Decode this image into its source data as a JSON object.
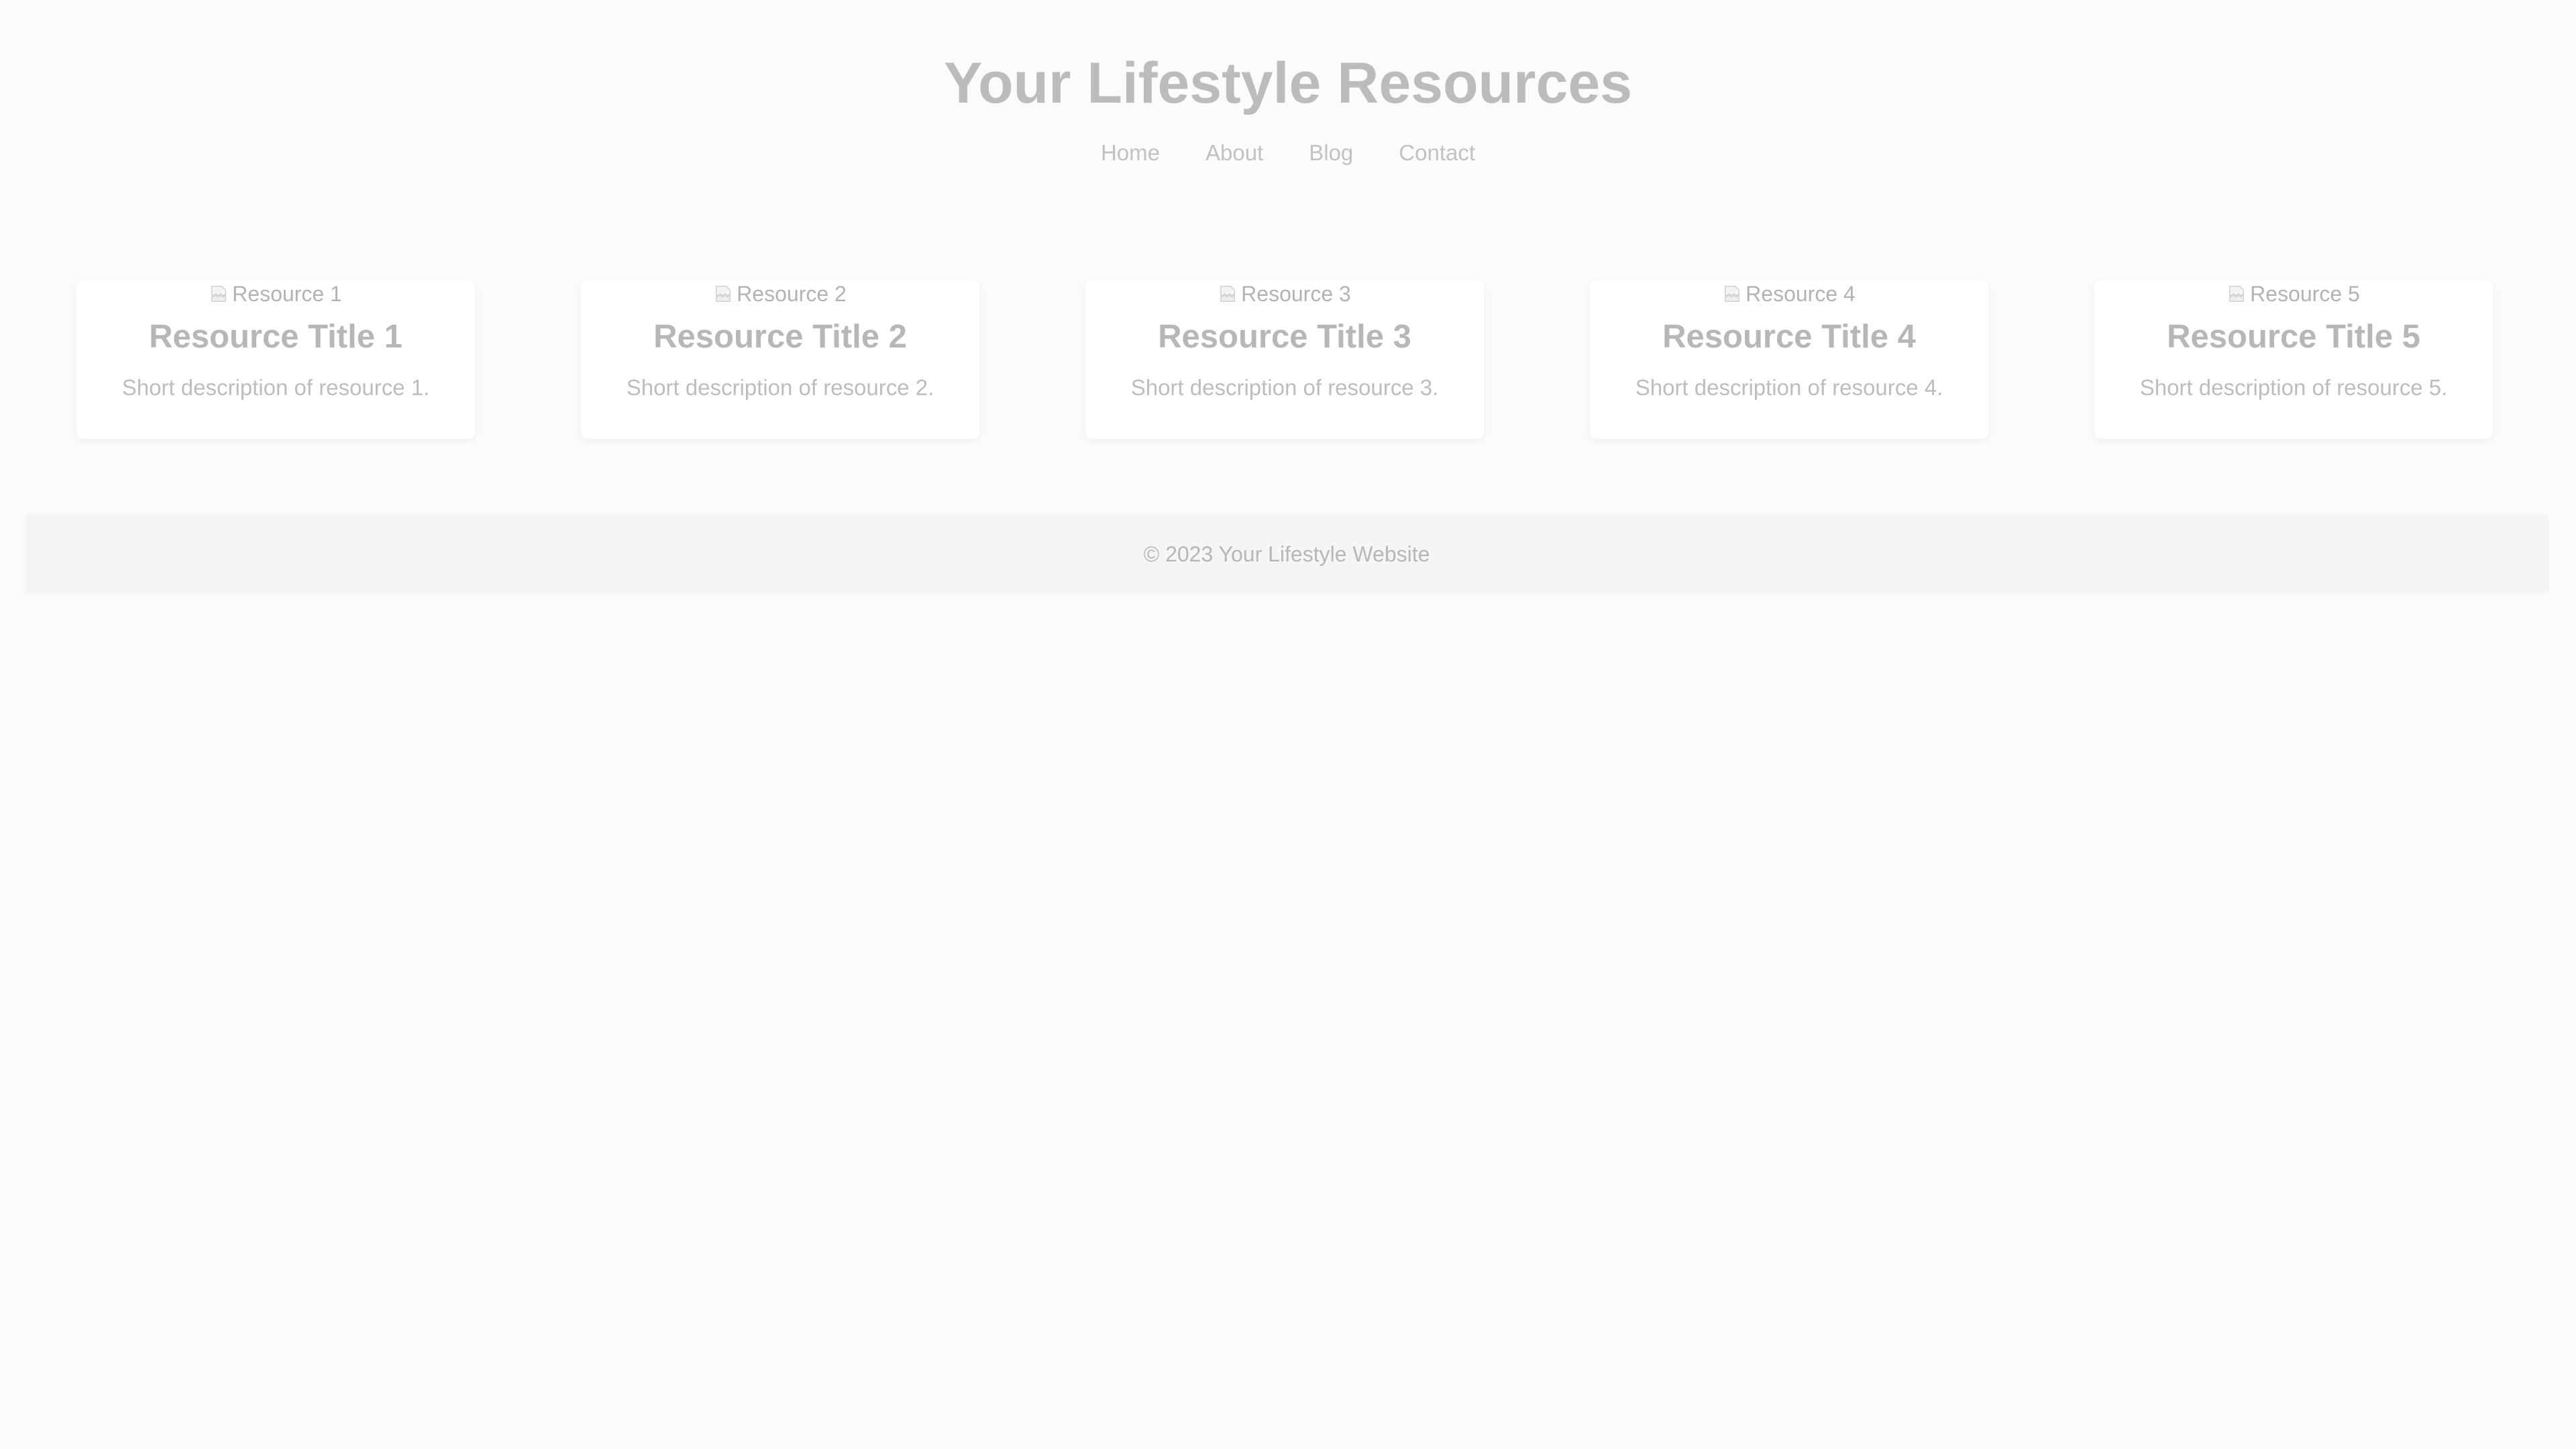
{
  "header": {
    "title": "Your Lifestyle Resources",
    "nav": [
      "Home",
      "About",
      "Blog",
      "Contact"
    ]
  },
  "resources": [
    {
      "image_alt": "Resource 1",
      "title": "Resource Title 1",
      "description": "Short description of resource 1."
    },
    {
      "image_alt": "Resource 2",
      "title": "Resource Title 2",
      "description": "Short description of resource 2."
    },
    {
      "image_alt": "Resource 3",
      "title": "Resource Title 3",
      "description": "Short description of resource 3."
    },
    {
      "image_alt": "Resource 4",
      "title": "Resource Title 4",
      "description": "Short description of resource 4."
    },
    {
      "image_alt": "Resource 5",
      "title": "Resource Title 5",
      "description": "Short description of resource 5."
    }
  ],
  "footer": {
    "text": "© 2023 Your Lifestyle Website"
  },
  "icons": {
    "broken_image": "broken-image-icon"
  },
  "colors": {
    "background": "#fbfbfb",
    "card": "#ffffff",
    "footer": "#f5f5f5",
    "text": "#b9b9b9"
  }
}
